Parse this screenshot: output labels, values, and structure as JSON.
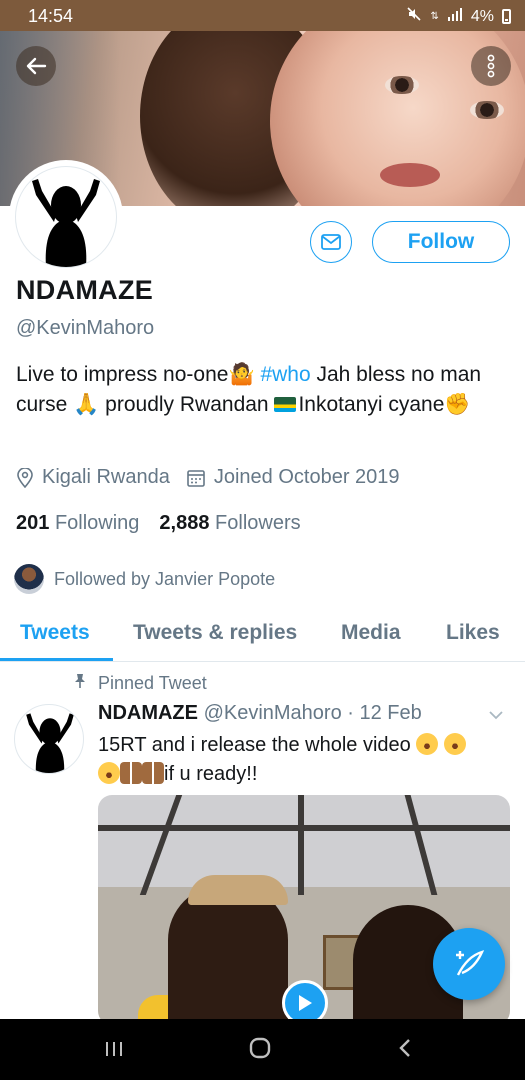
{
  "status_bar": {
    "time": "14:54",
    "battery": "4%",
    "icons": [
      "mute-icon",
      "data-icon",
      "signal-icon",
      "battery-icon"
    ]
  },
  "header": {
    "back_icon": "arrow-left-icon",
    "more_icon": "more-vertical-icon"
  },
  "profile": {
    "follow_label": "Follow",
    "display_name": "NDAMAZE",
    "handle": "@KevinMahoro",
    "bio": {
      "part1": "Live to impress no-one",
      "hashtag": "#who",
      "part2": " Jah bless no man curse ",
      "part3": " proudly Rwandan ",
      "part4": "Inkotanyi cyane"
    },
    "location": "Kigali Rwanda",
    "joined": "Joined October 2019",
    "following_count": "201",
    "following_label": "Following",
    "followers_count": "2,888",
    "followers_label": "Followers",
    "followed_by": "Followed by Janvier Popote"
  },
  "tabs": [
    {
      "label": "Tweets",
      "active": true
    },
    {
      "label": "Tweets & replies",
      "active": false
    },
    {
      "label": "Media",
      "active": false
    },
    {
      "label": "Likes",
      "active": false
    }
  ],
  "tweet": {
    "pinned_label": "Pinned Tweet",
    "author_name": "NDAMAZE",
    "author_handle": "@KevinMahoro",
    "separator": " · ",
    "date": "12 Feb",
    "text1": "15RT and i release the whole video ",
    "text2": "if u ready!!"
  },
  "colors": {
    "accent": "#1da1f2",
    "secondary_text": "#657786"
  }
}
